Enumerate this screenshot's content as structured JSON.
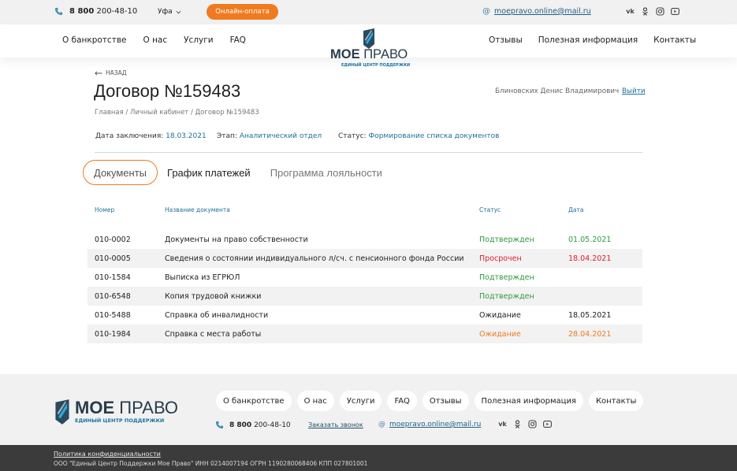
{
  "topbar": {
    "phone_prefix": "8 800",
    "phone_number": "200-48-10",
    "city": "Уфа",
    "pay_button": "Онлайн-оплата",
    "email": "moepravo.online@mail.ru",
    "socials": [
      "vk-icon",
      "ok-icon",
      "instagram-icon",
      "youtube-icon"
    ]
  },
  "header": {
    "nav_left": [
      "О банкротстве",
      "О нас",
      "Услуги",
      "FAQ"
    ],
    "nav_right": [
      "Отзывы",
      "Полезная информация",
      "Контакты"
    ],
    "logo_name_bold": "МОЕ",
    "logo_name_light": "ПРАВО",
    "logo_tagline": "ЕДИНЫЙ ЦЕНТР ПОДДЕРЖКИ"
  },
  "page": {
    "back_label": "НАЗАД",
    "title": "Договор №159483",
    "breadcrumb": "Главная / Личный кабинет / Договор №159483",
    "user_name": "Блиновских Денис Владимирович",
    "logout_label": "Выйти",
    "meta": {
      "date_label": "Дата заключения:",
      "date_value": "18.03.2021",
      "stage_label": "Этап:",
      "stage_value": "Аналитический отдел",
      "status_label": "Статус:",
      "status_value": "Формирование списка документов"
    },
    "tabs": [
      "Документы",
      "График платежей",
      "Программа лояльности"
    ]
  },
  "table": {
    "headers": [
      "Номер",
      "Название документа",
      "Статус",
      "Дата"
    ],
    "rows": [
      {
        "number": "010-0002",
        "name": "Документы на право собственности",
        "status": "Подтвержден",
        "date": "01.05.2021",
        "tone": "green"
      },
      {
        "number": "010-0005",
        "name": "Сведения о состоянии  индивидуального л/сч. с пенсионного фонда России",
        "status": "Просрочен",
        "date": "18.04.2021",
        "tone": "red"
      },
      {
        "number": "010-1584",
        "name": "Выписка из ЕГРЮЛ",
        "status": "Подтвержден",
        "date": "",
        "tone": "green"
      },
      {
        "number": "010-6548",
        "name": "Копия трудовой книжки",
        "status": "Подтвержден",
        "date": "",
        "tone": "green"
      },
      {
        "number": "010-5488",
        "name": "Справка об инвалидности",
        "status": "Ожидание",
        "date": "18.05.2021",
        "tone": "plain"
      },
      {
        "number": "010-1984",
        "name": "Справка с места работы",
        "status": "Ожидание",
        "date": "28.04.2021",
        "tone": "orange"
      }
    ]
  },
  "footer": {
    "logo_name_bold": "МОЕ",
    "logo_name_light": "ПРАВО",
    "logo_tagline": "ЕДИНЫЙ ЦЕНТР ПОДДЕРЖКИ",
    "nav": [
      "О банкротстве",
      "О нас",
      "Услуги",
      "FAQ",
      "Отзывы",
      "Полезная информация",
      "Контакты"
    ],
    "phone_prefix": "8 800",
    "phone_number": "200-48-10",
    "callback": "Заказать звонок",
    "email": "moepravo.online@mail.ru",
    "policy": "Политика конфиденциальности",
    "legal": "ООО \"Единый Центр Поддержки Мое Право\" ИНН 0214007194 ОГРН 1190280068406 КПП 027801001"
  },
  "colors": {
    "accent": "#f07a1f",
    "link": "#1f6f99",
    "confirmed": "#2e9b3d",
    "overdue": "#e11a2a"
  }
}
